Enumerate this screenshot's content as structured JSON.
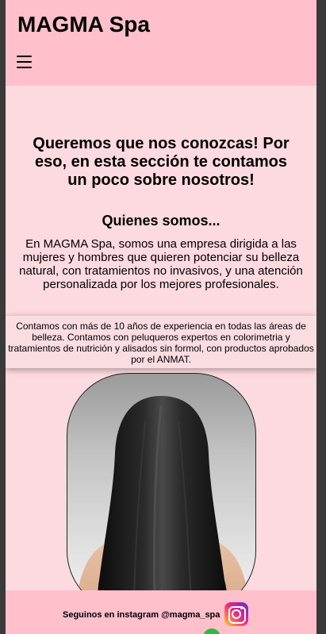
{
  "header": {
    "brand": "MAGMA Spa"
  },
  "intro": {
    "heading": "Queremos que nos conozcas! Por eso, en esta sección te contamos un poco sobre nosotros!"
  },
  "about": {
    "title": "Quienes somos...",
    "text": "En MAGMA Spa, somos una empresa dirigida a las mujeres y hombres que quieren potenciar su belleza natural, con tratamientos no invasivos, y una atención personalizada por los mejores profesionales.",
    "experience": "Contamos con más de 10 años de experiencia en todas las áreas de belleza. Contamos con peluqueros expertos en colorimetria y tratamientos de nutrición y alisados sin formol, con productos aprobados por el ANMAT."
  },
  "footer": {
    "instagram_text": "Seguinos en instagram @magma_spa"
  },
  "colors": {
    "header_bg": "#ffc0cb",
    "page_bg": "#fcdadf"
  },
  "icons": {
    "menu": "hamburger-menu-icon",
    "instagram": "instagram-icon",
    "whatsapp": "whatsapp-icon"
  }
}
